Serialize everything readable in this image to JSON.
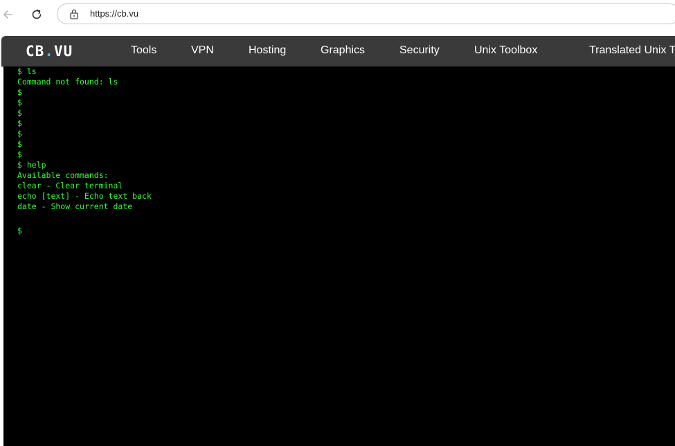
{
  "browser": {
    "url": "https://cb.vu",
    "back_icon": "arrow-left-icon",
    "reload_icon": "reload-icon",
    "lock_icon": "lock-icon"
  },
  "site": {
    "logo_main": "CB",
    "logo_dot": ".",
    "logo_tail": "VU",
    "nav": [
      "Tools",
      "VPN",
      "Hosting",
      "Graphics",
      "Security",
      "Unix Toolbox",
      "Translated Unix T"
    ]
  },
  "terminal": {
    "lines": [
      "$ ls",
      "Command not found: ls",
      "$",
      "$",
      "$",
      "$",
      "$",
      "$",
      "$",
      "$ help",
      "Available commands:",
      "clear - Clear terminal",
      "echo [text] - Echo text back",
      "date - Show current date"
    ],
    "prompt": "$",
    "input_value": ""
  },
  "colors": {
    "header_bg": "#3a3a3a",
    "terminal_bg": "#000000",
    "terminal_text": "#33ff33",
    "logo_dot": "#2ec4e8"
  }
}
